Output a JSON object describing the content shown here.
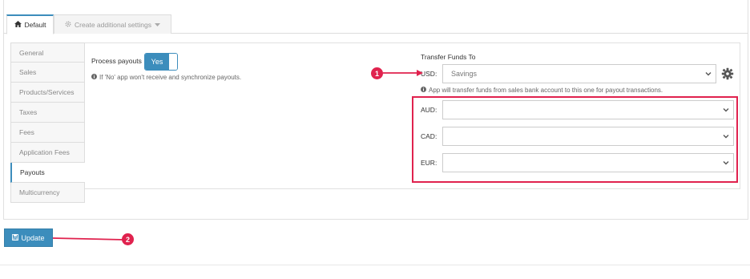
{
  "tabs": [
    {
      "label": "Default",
      "icon": "home-icon"
    },
    {
      "label": "Create additional settings",
      "icon": "gear-icon"
    }
  ],
  "sidebar": {
    "items": [
      {
        "label": "General"
      },
      {
        "label": "Sales"
      },
      {
        "label": "Products/Services"
      },
      {
        "label": "Taxes"
      },
      {
        "label": "Fees"
      },
      {
        "label": "Application Fees"
      },
      {
        "label": "Payouts"
      },
      {
        "label": "Multicurrency"
      }
    ],
    "active": "Payouts"
  },
  "process_payouts": {
    "label": "Process payouts",
    "toggle_value": "Yes",
    "hint": "If 'No' app won't receive and synchronize payouts."
  },
  "transfer": {
    "title": "Transfer Funds To",
    "usd": {
      "label": "USD:",
      "value": "Savings"
    },
    "hint": "App will transfer funds from sales bank account to this one for payout transactions.",
    "currencies": [
      {
        "label": "AUD:",
        "value": ""
      },
      {
        "label": "CAD:",
        "value": ""
      },
      {
        "label": "EUR:",
        "value": ""
      }
    ]
  },
  "annotations": {
    "badge1": "1",
    "badge2": "2",
    "color": "#e0224e"
  },
  "update_button": {
    "label": "Update",
    "icon": "save-icon"
  },
  "colors": {
    "primary": "#3c8dbc",
    "highlight": "#e0224e"
  }
}
